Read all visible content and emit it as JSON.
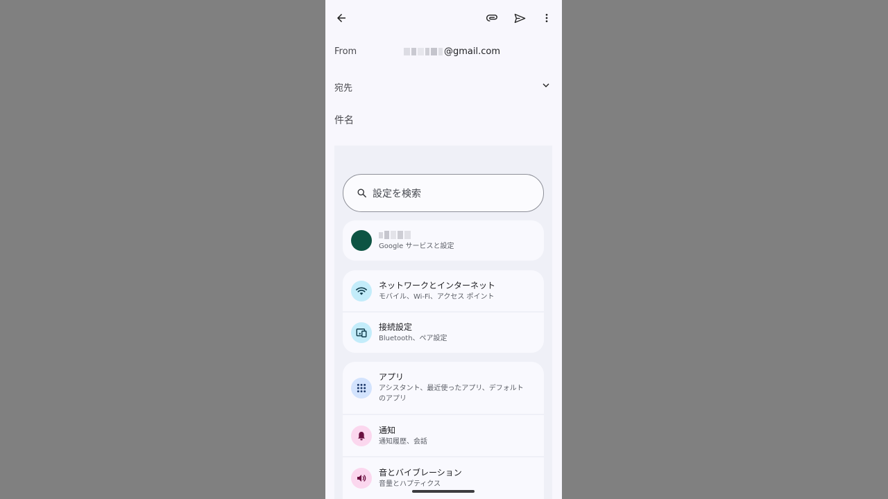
{
  "compose": {
    "from_label": "From",
    "from_email": "@gmail.com",
    "to_label": "宛先",
    "subject_label": "件名"
  },
  "settings": {
    "search_placeholder": "設定を検索",
    "account": {
      "subtitle": "Google サービスと設定",
      "avatar_color": "#0d5443"
    },
    "groups": [
      [
        {
          "title": "ネットワークとインターネット",
          "subtitle": "モバイル、Wi-Fi、アクセス ポイント",
          "icon": "wifi-icon",
          "icon_bg": "#c3ecfa"
        },
        {
          "title": "接続設定",
          "subtitle": "Bluetooth、ペア設定",
          "icon": "connected-devices-icon",
          "icon_bg": "#c3ecfa"
        }
      ],
      [
        {
          "title": "アプリ",
          "subtitle_lines": [
            "アシスタント、最近使ったアプリ、デフォルト",
            "のアプリ"
          ],
          "icon": "apps-grid-icon",
          "icon_bg": "#d3e3fd"
        },
        {
          "title": "通知",
          "subtitle": "通知履歴、会話",
          "icon": "bell-icon",
          "icon_bg": "#fbd7ee"
        },
        {
          "title": "音とバイブレーション",
          "subtitle": "音量とハプティクス",
          "icon": "volume-icon",
          "icon_bg": "#fbd7ee"
        }
      ]
    ]
  }
}
